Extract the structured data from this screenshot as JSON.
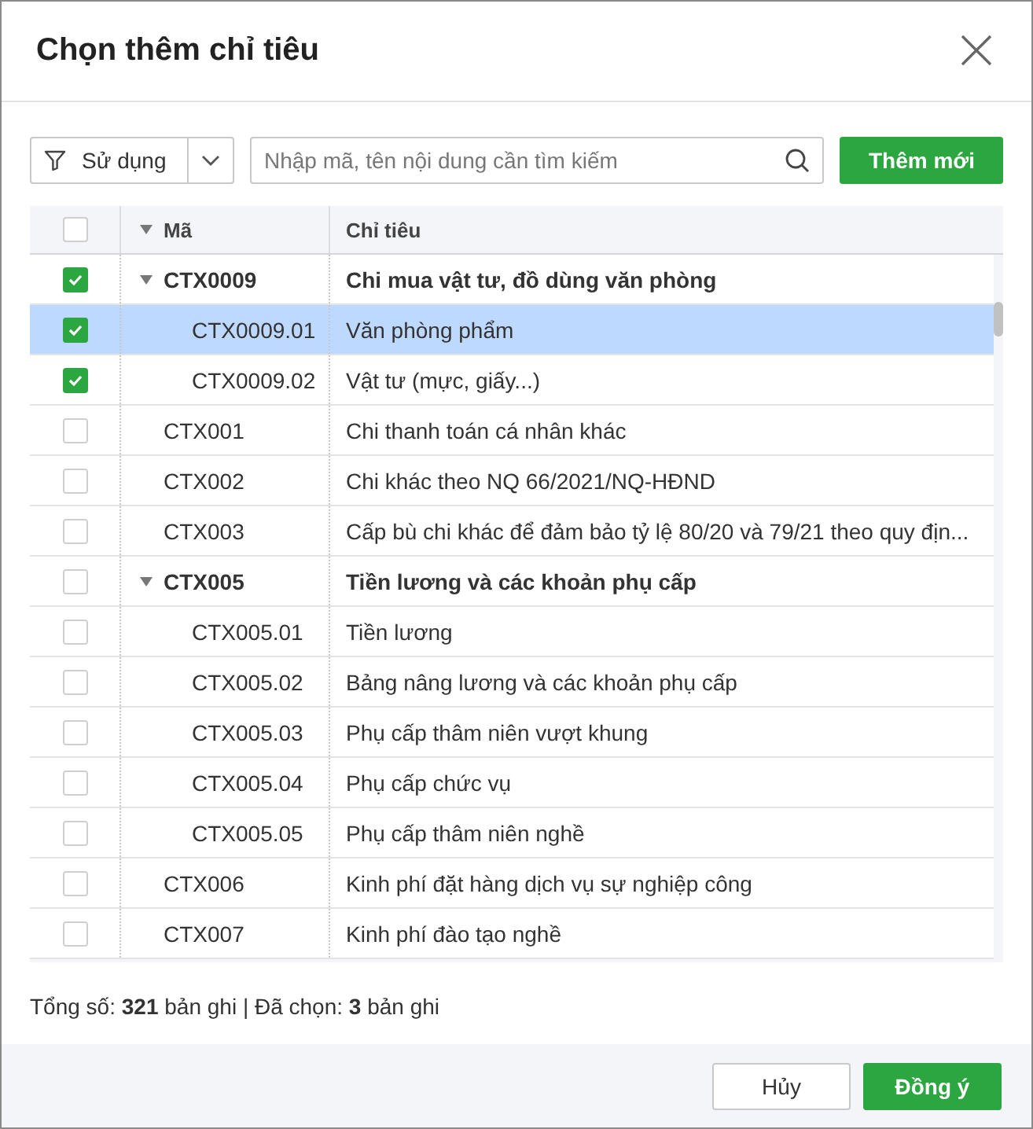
{
  "dialog": {
    "title": "Chọn thêm chỉ tiêu"
  },
  "filter": {
    "value": "Sử dụng"
  },
  "search": {
    "placeholder": "Nhập mã, tên nội dung cần tìm kiếm"
  },
  "add_button": "Thêm mới",
  "table": {
    "columns": [
      "Mã",
      "Chỉ tiêu"
    ],
    "header_checked": false,
    "rows": [
      {
        "code": "CTX0009",
        "name": "Chi mua vật tư, đồ dùng văn phòng",
        "checked": true,
        "selected": false,
        "expanded": true,
        "children": [
          {
            "code": "CTX0009.01",
            "name": "Văn phòng phẩm",
            "checked": true,
            "selected": true
          },
          {
            "code": "CTX0009.02",
            "name": "Vật tư (mực, giấy...)",
            "checked": true,
            "selected": false
          }
        ]
      },
      {
        "code": "CTX001",
        "name": "Chi thanh toán cá nhân khác",
        "checked": false,
        "selected": false
      },
      {
        "code": "CTX002",
        "name": "Chi khác theo NQ 66/2021/NQ-HĐND",
        "checked": false,
        "selected": false
      },
      {
        "code": "CTX003",
        "name": "Cấp bù chi khác để đảm bảo tỷ lệ 80/20 và 79/21 theo quy địn...",
        "checked": false,
        "selected": false
      },
      {
        "code": "CTX005",
        "name": "Tiền lương và các khoản phụ cấp",
        "checked": false,
        "selected": false,
        "expanded": true,
        "children": [
          {
            "code": "CTX005.01",
            "name": "Tiền lương",
            "checked": false,
            "selected": false
          },
          {
            "code": "CTX005.02",
            "name": "Bảng nâng lương và các khoản phụ cấp",
            "checked": false,
            "selected": false
          },
          {
            "code": "CTX005.03",
            "name": "Phụ cấp thâm niên vượt khung",
            "checked": false,
            "selected": false
          },
          {
            "code": "CTX005.04",
            "name": "Phụ cấp chức vụ",
            "checked": false,
            "selected": false
          },
          {
            "code": "CTX005.05",
            "name": "Phụ cấp thâm niên nghề",
            "checked": false,
            "selected": false
          }
        ]
      },
      {
        "code": "CTX006",
        "name": "Kinh phí đặt hàng dịch vụ sự nghiệp công",
        "checked": false,
        "selected": false
      },
      {
        "code": "CTX007",
        "name": "Kinh phí đào tạo nghề",
        "checked": false,
        "selected": false
      }
    ]
  },
  "summary": "Tổng số:  **321** bản ghi | Đã chọn:  **3** bản ghi",
  "buttons": {
    "cancel": "Hủy",
    "confirm": "Đồng ý"
  }
}
